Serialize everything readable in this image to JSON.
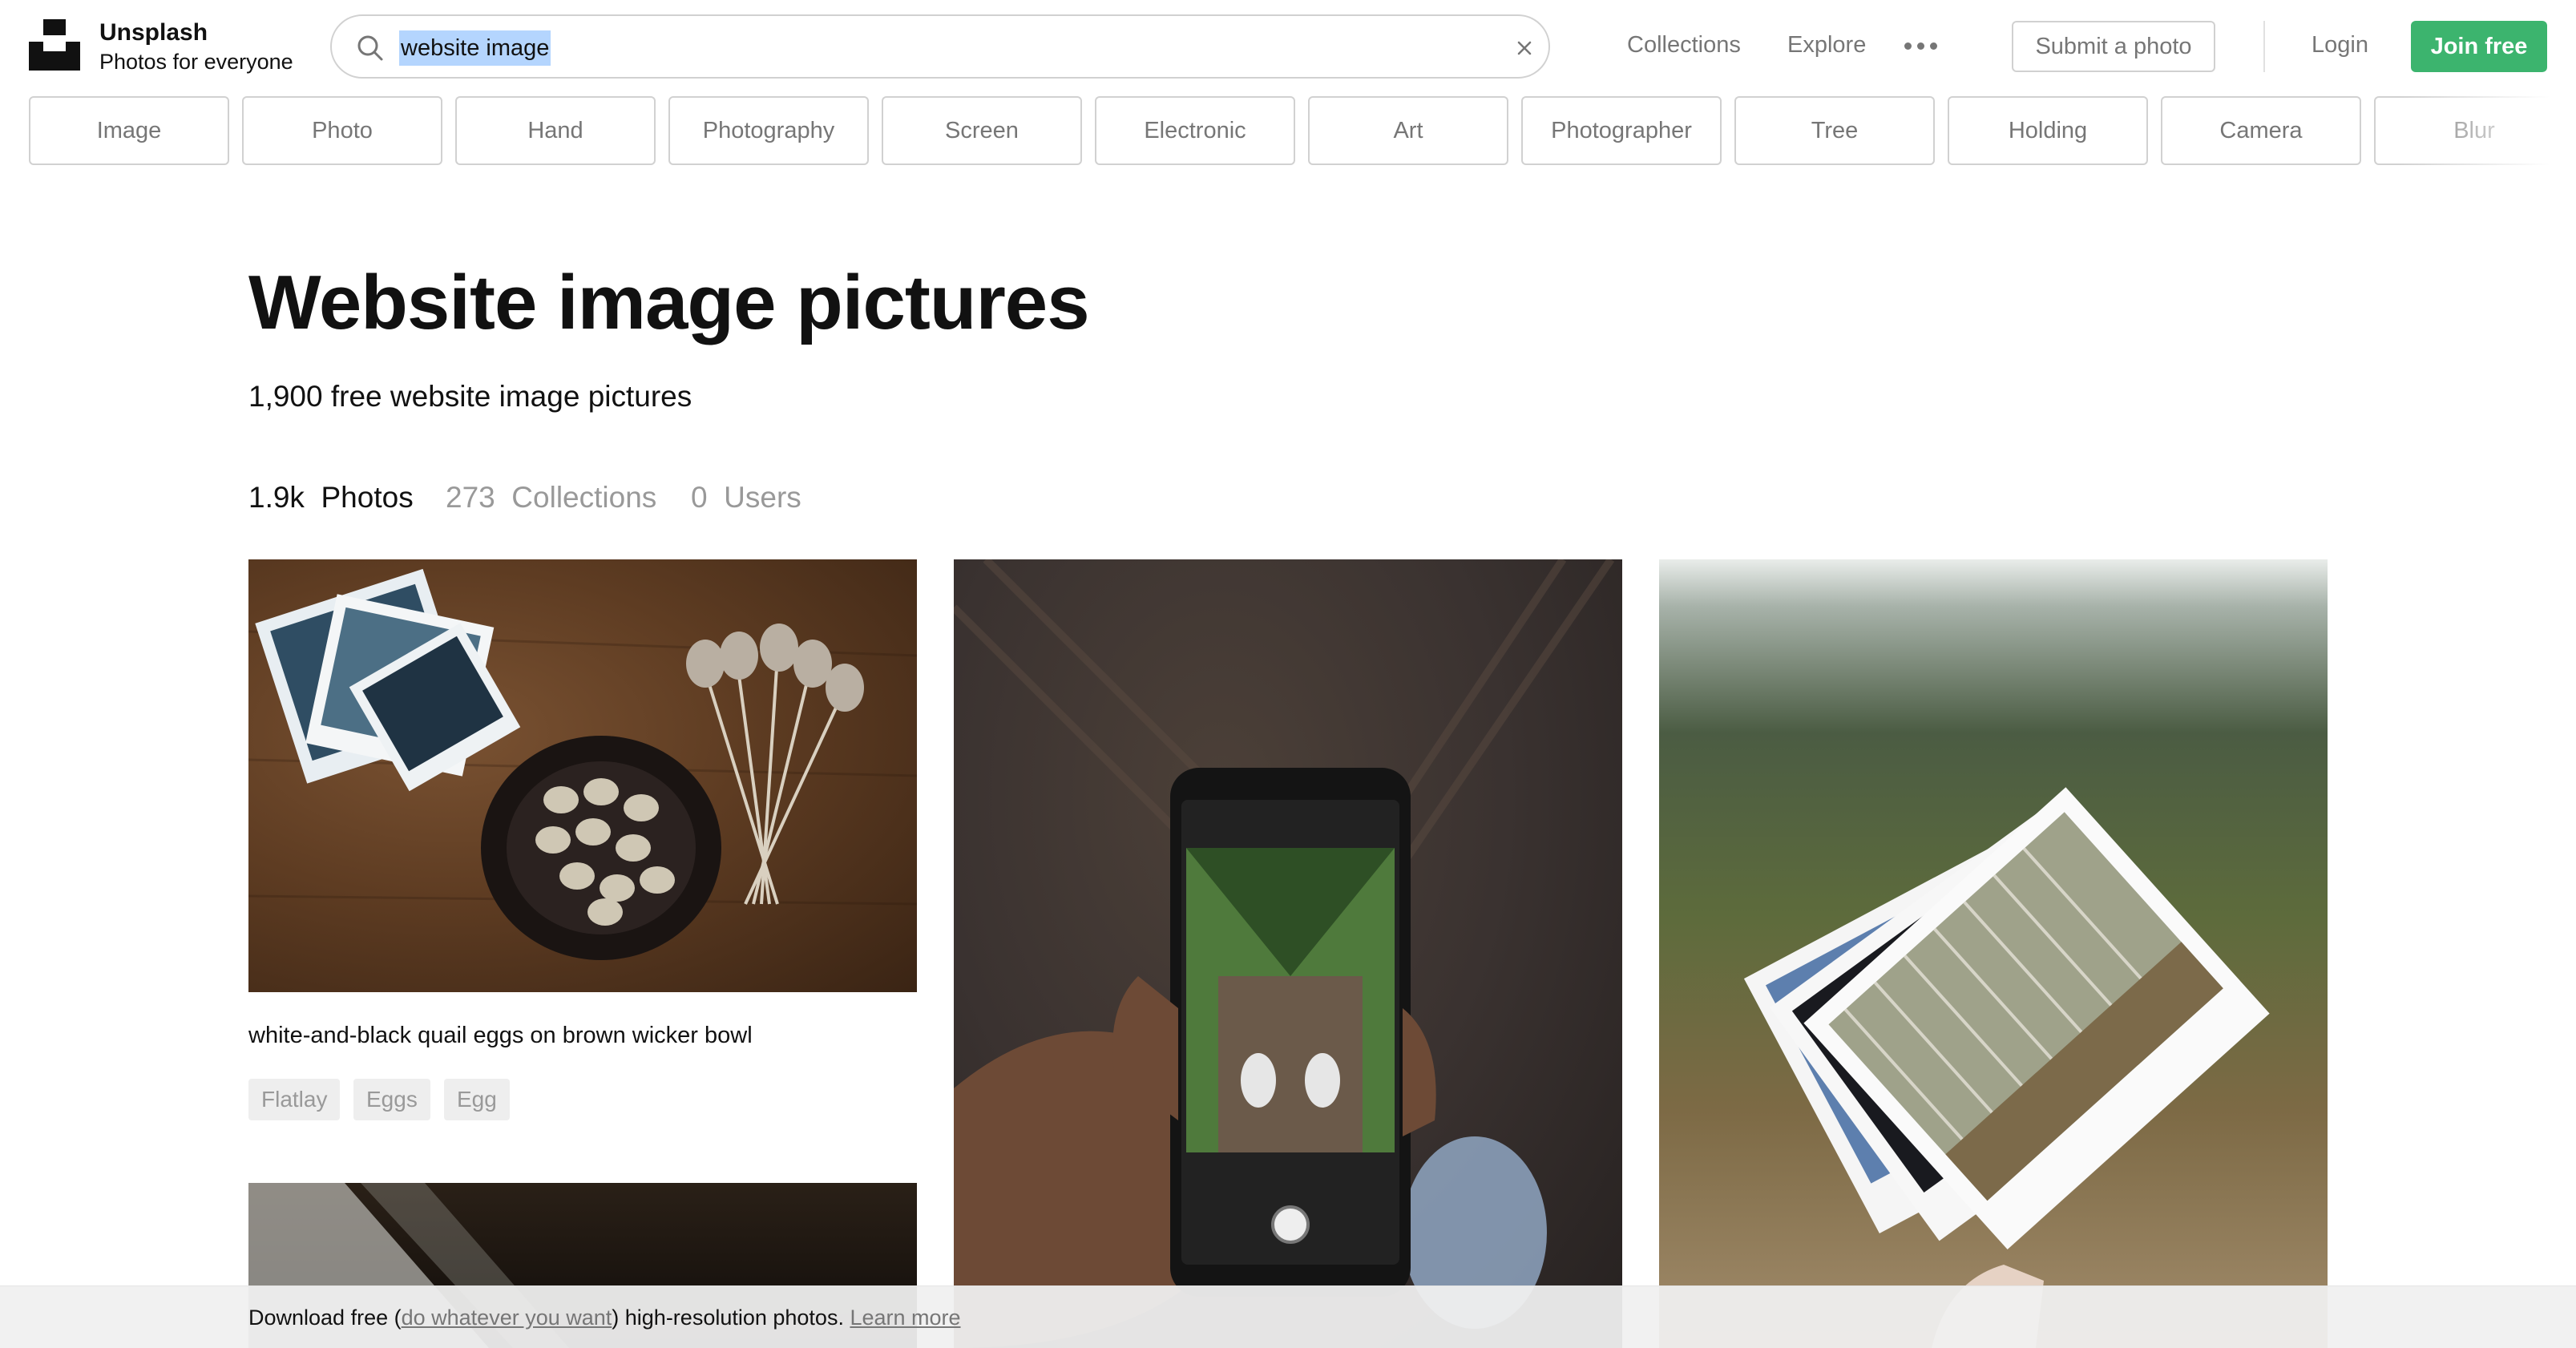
{
  "header": {
    "brand_name": "Unsplash",
    "brand_tagline": "Photos for everyone",
    "search_value": "website image",
    "nav_collections": "Collections",
    "nav_explore": "Explore",
    "submit_label": "Submit a photo",
    "login_label": "Login",
    "join_label": "Join free"
  },
  "related_tags": [
    "Image",
    "Photo",
    "Hand",
    "Photography",
    "Screen",
    "Electronic",
    "Art",
    "Photographer",
    "Tree",
    "Holding",
    "Camera",
    "Blur"
  ],
  "main": {
    "title": "Website image pictures",
    "subtitle": "1,900 free website image pictures",
    "stats": [
      {
        "count": "1.9k",
        "label": "Photos"
      },
      {
        "count": "273",
        "label": "Collections"
      },
      {
        "count": "0",
        "label": "Users"
      }
    ]
  },
  "photos": [
    {
      "caption": "white-and-black quail eggs on brown wicker bowl",
      "tags": [
        "Flatlay",
        "Eggs",
        "Egg"
      ]
    }
  ],
  "banner": {
    "prefix": "Download free (",
    "link_text": "do whatever you want",
    "middle": ") high-resolution photos. ",
    "learn_more": "Learn more"
  },
  "colors": {
    "accent_green": "#3cb46e",
    "muted_text": "#767676",
    "selection_highlight": "#b4d5fe"
  },
  "icons": [
    "unsplash-logo",
    "search-icon",
    "clear-icon",
    "more-dots-icon"
  ]
}
